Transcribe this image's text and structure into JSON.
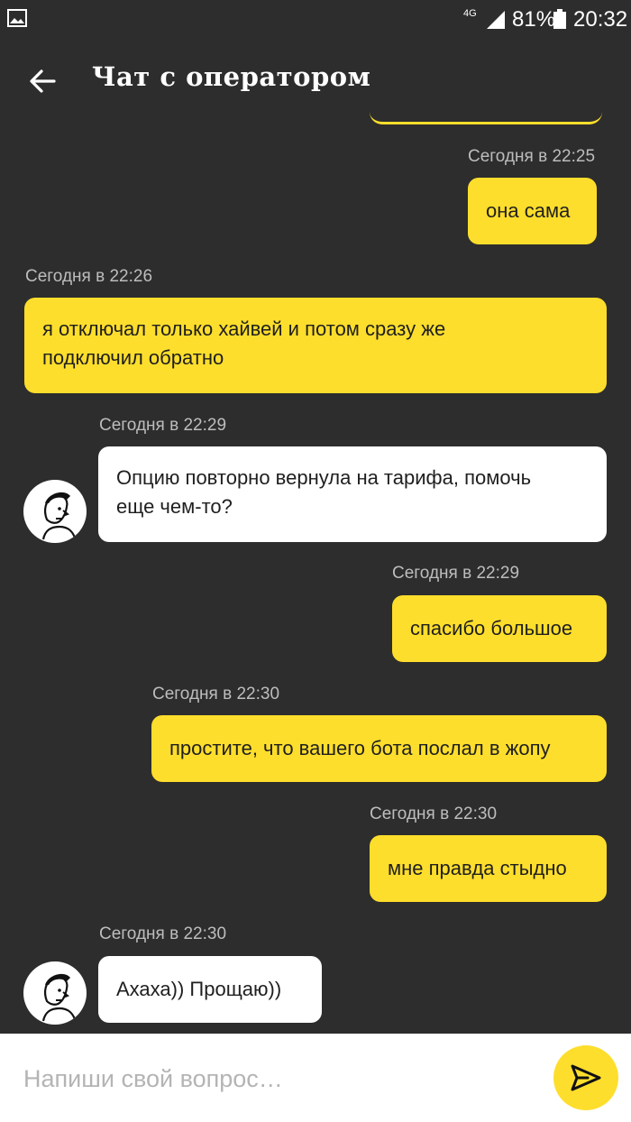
{
  "status_bar": {
    "network": "4G",
    "battery_percent": "81%",
    "time": "20:32"
  },
  "header": {
    "title": "Чат с оператором"
  },
  "messages": [
    {
      "time": "Сегодня в 22:25",
      "lines": [
        "она сама"
      ],
      "sender": "user"
    },
    {
      "time": "Сегодня в 22:26",
      "lines": [
        "я отключал только хайвей и потом сразу же",
        "подключил обратно"
      ],
      "sender": "user"
    },
    {
      "time": "Сегодня в 22:29",
      "lines": [
        "Опцию повторно вернула на тарифа, помочь",
        "еще чем-то?"
      ],
      "sender": "operator"
    },
    {
      "time": "Сегодня в 22:29",
      "lines": [
        "спасибо большое"
      ],
      "sender": "user"
    },
    {
      "time": "Сегодня в 22:30",
      "lines": [
        "простите, что вашего бота послал в жопу"
      ],
      "sender": "user"
    },
    {
      "time": "Сегодня в 22:30",
      "lines": [
        "мне правда стыдно"
      ],
      "sender": "user"
    },
    {
      "time": "Сегодня в 22:30",
      "lines": [
        "Ахаха)) Прощаю))"
      ],
      "sender": "operator"
    }
  ],
  "input": {
    "placeholder": "Напиши свой вопрос…",
    "value": ""
  },
  "icons": {
    "back": "arrow-left-icon",
    "send": "send-icon",
    "gallery": "image-icon",
    "avatar": "operator-avatar"
  },
  "colors": {
    "background": "#2d2d2d",
    "user_bubble": "#fede2c",
    "operator_bubble": "#ffffff",
    "timestamp": "#bdbdbd",
    "input_bar": "#ffffff"
  }
}
